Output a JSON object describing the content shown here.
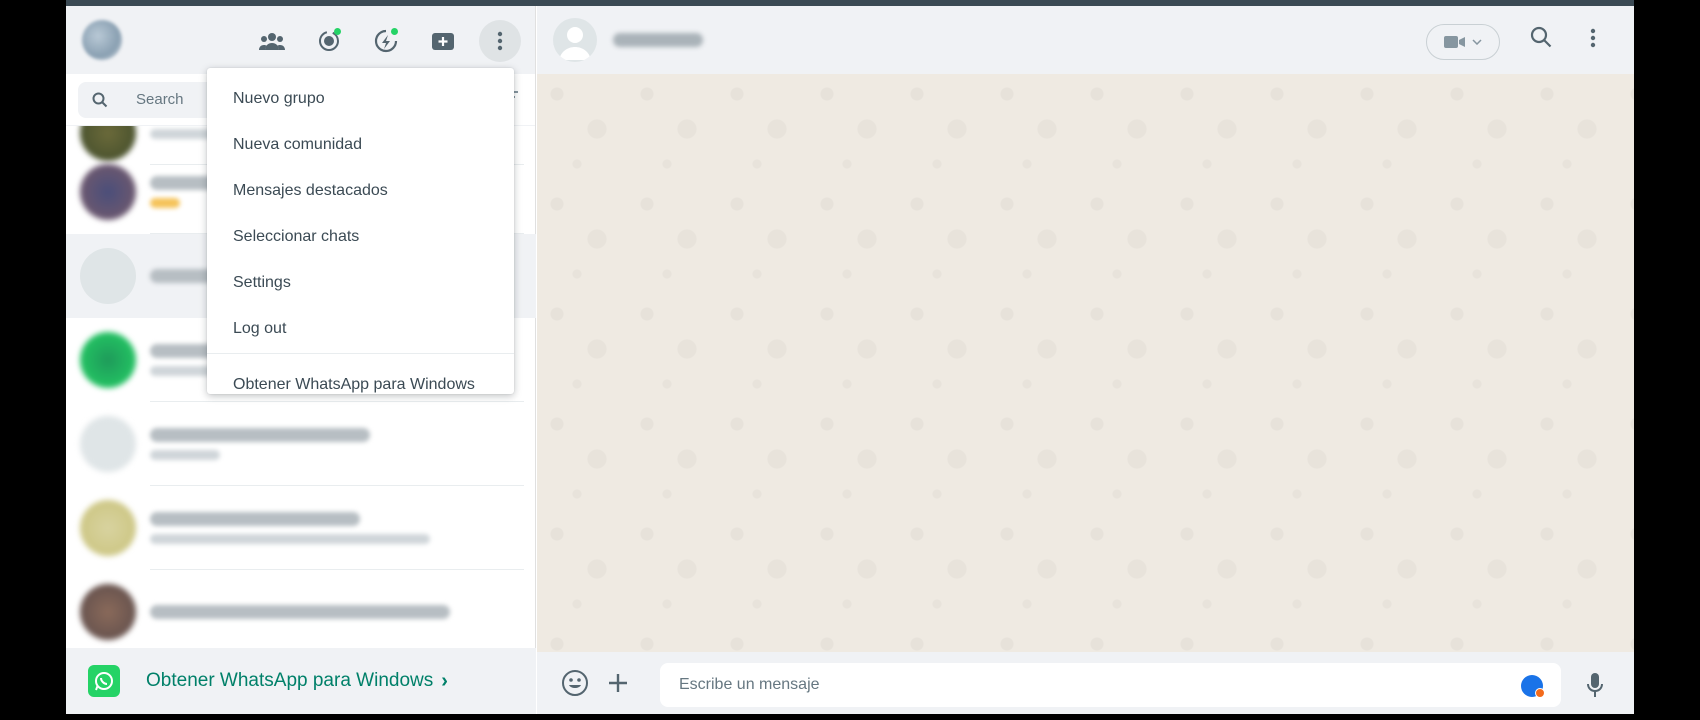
{
  "left": {
    "search": {
      "placeholder": "Search"
    },
    "promo": {
      "label": "Obtener WhatsApp para Windows",
      "chevron": "›"
    }
  },
  "menu": {
    "items": [
      {
        "label": "Nuevo grupo"
      },
      {
        "label": "Nueva comunidad"
      },
      {
        "label": "Mensajes destacados"
      },
      {
        "label": "Seleccionar chats"
      },
      {
        "label": "Settings"
      },
      {
        "label": "Log out"
      }
    ],
    "footer": "Obtener WhatsApp para Windows"
  },
  "composer": {
    "placeholder": "Escribe un mensaje"
  },
  "icons": [
    "communities-icon",
    "status-icon",
    "channels-icon",
    "new-chat-icon",
    "menu-icon",
    "search-icon",
    "filter-icon",
    "video-call-icon",
    "emoji-icon",
    "attach-icon",
    "mic-icon",
    "whatsapp-logo-icon"
  ],
  "colors": {
    "accent": "#008069",
    "whatsapp_green": "#25d366",
    "header_bg": "#f0f2f5",
    "chat_bg": "#efeae2"
  }
}
